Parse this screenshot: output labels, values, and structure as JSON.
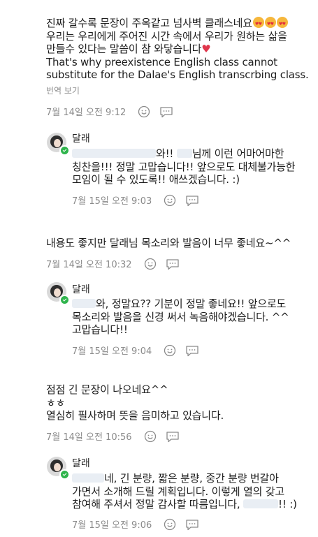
{
  "comments": [
    {
      "lines": [
        "진짜 갈수록 문장이 주옥같고 넘사벽 클래스네요",
        "우리는 우리에게 주어진 시간 속에서 우리가 원하는 삶을",
        "만들수 있다는 말씀이 참 와닿습니다",
        "That's why preexistence English class cannot",
        "substitute for the Dalae's English transcrbing class."
      ],
      "translate_label": "번역 보기",
      "date": "7월 14일 오전 9:12"
    },
    {
      "lines": [
        "님께 이런 어마어마한",
        "칭찬을!!! 정말 고맙습니다!! 앞으로도 대체불가능한",
        "모임이 될 수 있도록!! 애쓰겠습니다. :)"
      ],
      "line1_prefix": "와!!",
      "author": "달래",
      "date": "7월 15일 오전 9:03"
    },
    {
      "lines": [
        "내용도 좋지만 달래님 목소리와 발음이 너무 좋네요~^^"
      ],
      "date": "7월 14일 오전 10:32"
    },
    {
      "lines": [
        "와, 정말요?? 기분이 정말 좋네요!! 앞으로도",
        "목소리와 발음을 신경 써서 녹음해야겠습니다. ^^",
        "고맙습니다!!"
      ],
      "author": "달래",
      "date": "7월 15일 오전 9:04"
    },
    {
      "lines": [
        "점점 긴 문장이 나오네요^^",
        "ㅎㅎ",
        "열심히 필사하며 뜻을 음미하고 있습니다."
      ],
      "date": "7월 14일 오전 10:56"
    },
    {
      "lines": [
        "네, 긴 분량, 짧은 분량, 중간 분량 번갈아",
        "가면서 소개해 드릴 계획입니다. 이렇게 열의 갖고",
        "참여해 주셔서 정말 감사할 따름입니다,",
        "!! :)"
      ],
      "author": "달래",
      "date": "7월 15일 오전 9:06"
    }
  ],
  "icons": {
    "like": "smile-face-icon",
    "reply": "speech-bubble-icon",
    "heart": "red-heart",
    "emoji": "heart-eyes-emoji"
  },
  "colors": {
    "text": "#1e1e1e",
    "meta": "#8a8a8a",
    "badge": "#2fb44c",
    "heart": "#e0364c"
  }
}
